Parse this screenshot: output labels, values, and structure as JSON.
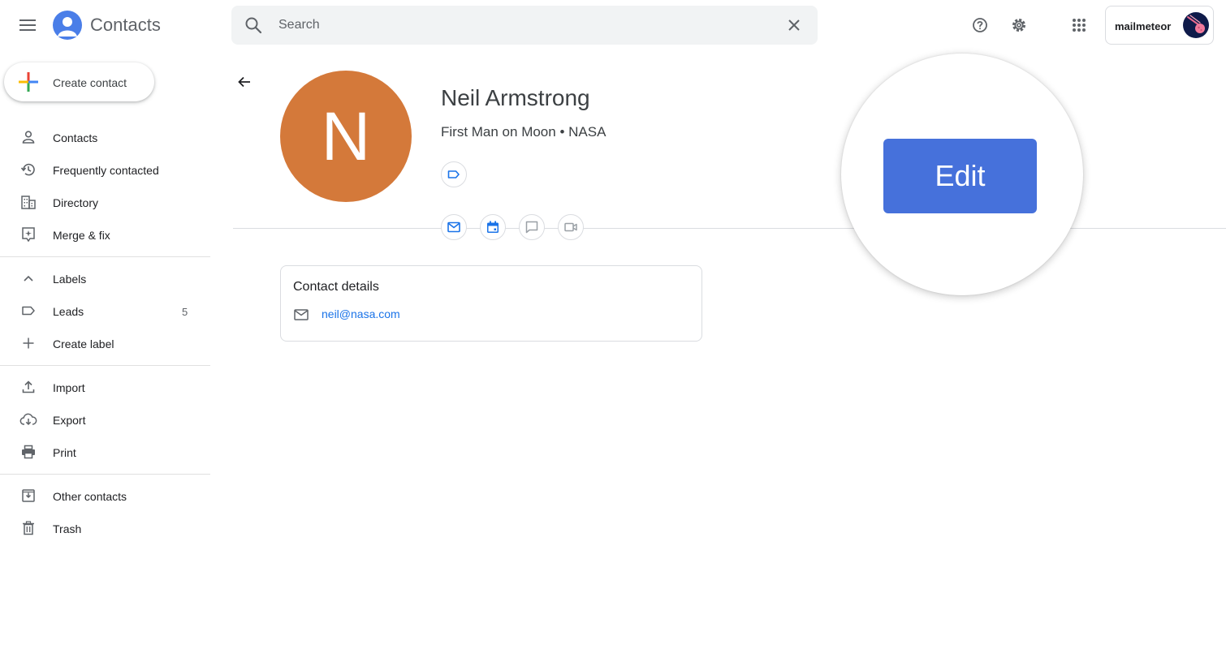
{
  "header": {
    "app_title": "Contacts",
    "search_placeholder": "Search",
    "account_name": "mailmeteor"
  },
  "sidebar": {
    "create_label": "Create contact",
    "items": [
      {
        "label": "Contacts",
        "icon": "person-icon"
      },
      {
        "label": "Frequently contacted",
        "icon": "history-icon"
      },
      {
        "label": "Directory",
        "icon": "building-icon"
      },
      {
        "label": "Merge & fix",
        "icon": "merge-fix-icon"
      }
    ],
    "labels_section": {
      "heading": "Labels",
      "items": [
        {
          "label": "Leads",
          "count": "5",
          "icon": "label-icon"
        }
      ],
      "create_label": "Create label"
    },
    "tools": [
      {
        "label": "Import",
        "icon": "upload-icon"
      },
      {
        "label": "Export",
        "icon": "cloud-download-icon"
      },
      {
        "label": "Print",
        "icon": "printer-icon"
      }
    ],
    "other": [
      {
        "label": "Other contacts",
        "icon": "archive-icon"
      },
      {
        "label": "Trash",
        "icon": "trash-icon"
      }
    ]
  },
  "contact": {
    "initial": "N",
    "name": "Neil Armstrong",
    "subtitle": "First Man on Moon • NASA",
    "avatar_color": "#d4793a",
    "details_title": "Contact details",
    "email": "neil@nasa.com"
  },
  "magnifier": {
    "edit_label": "Edit",
    "accent": "#4671db"
  }
}
